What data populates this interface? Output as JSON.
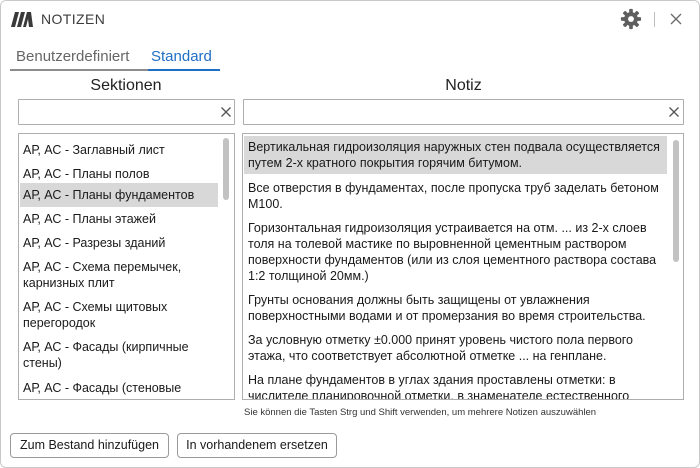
{
  "window": {
    "title": "NOTIZEN"
  },
  "tabs": [
    {
      "label": "Benutzerdefiniert",
      "active": false
    },
    {
      "label": "Standard",
      "active": true
    }
  ],
  "sections": {
    "heading": "Sektionen",
    "search_value": "",
    "items": [
      "АР, АС - Заглавный лист",
      "АР, АС - Планы полов",
      "АР, АС - Планы фундаментов",
      "АР, АС - Планы этажей",
      "АР, АС - Разрезы зданий",
      "АР, АС - Схема перемычек, карнизных плит",
      "АР, АС - Схемы щитовых перегородок",
      "АР, АС - Фасады (кирпичные стены)",
      "АР, АС - Фасады (стеновые панели)"
    ],
    "selected_index": 2
  },
  "notes": {
    "heading": "Notiz",
    "search_value": "",
    "items": [
      "Вертикальная гидроизоляция наружных стен подвала осуществляется путем 2-х кратного покрытия горячим битумом.",
      "Все отверстия в фундаментах, после пропуска труб заделать бетоном М100.",
      "Горизонтальная гидроизоляция устраивается на отм. ... из 2-х слоев толя на толевой мастике по выровненной цементным раствором поверхности фундаментов (или из слоя цементного раствора состава 1:2 толщиной 20мм.)",
      "Грунты основания должны быть защищены от увлажнения поверхностными водами и от промерзания во время строительства.",
      "За условную отметку ±0.000 принят уровень чистого пола первого этажа, что соответствует абсолютной отметке ... на генплане.",
      "На плане фундаментов в углах здания проставлены отметки: в числителе планировочной отметки, в знаменателе естественного рельефа."
    ],
    "selected_index": 0
  },
  "hint": "Sie können die Tasten Strg und Shift verwenden, um mehrere Notizen auszuwählen",
  "buttons": {
    "add": "Zum Bestand hinzufügen",
    "replace": "In vorhandenem ersetzen"
  },
  "colors": {
    "accent": "#1f6fc5",
    "selection": "#d8d8d8",
    "border": "#aeaeae"
  }
}
